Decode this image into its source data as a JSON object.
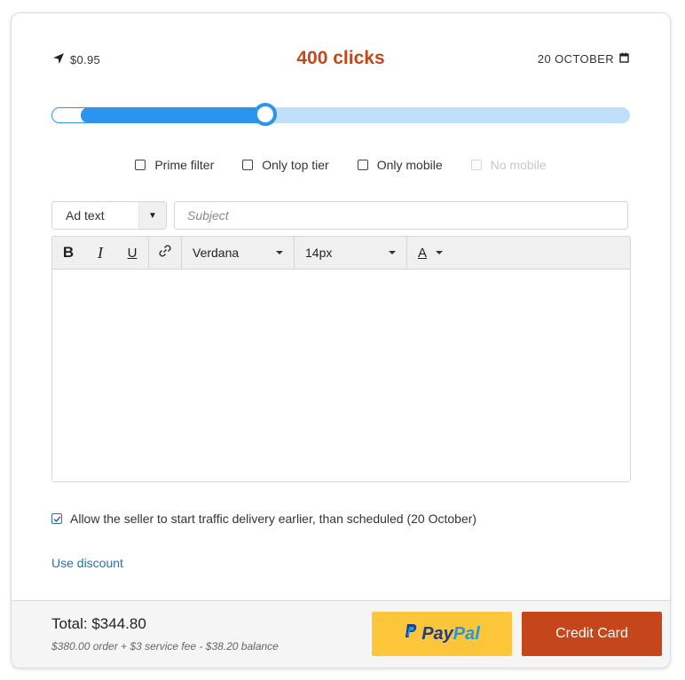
{
  "header": {
    "price": "$0.95",
    "clicks": "400 clicks",
    "date": "20 OCTOBER"
  },
  "slider": {
    "value_fraction": 0.37
  },
  "options": [
    {
      "label": "Prime filter",
      "checked": false,
      "disabled": false
    },
    {
      "label": "Only top tier",
      "checked": false,
      "disabled": false
    },
    {
      "label": "Only mobile",
      "checked": false,
      "disabled": false
    },
    {
      "label": "No mobile",
      "checked": false,
      "disabled": true
    }
  ],
  "ad_type": {
    "selected": "Ad text"
  },
  "subject": {
    "placeholder": "Subject",
    "value": ""
  },
  "editor": {
    "bold_icon": "B",
    "italic_icon": "I",
    "underline_icon": "U",
    "text_color_icon": "A",
    "font": "Verdana",
    "size": "14px",
    "content": ""
  },
  "allow_early": {
    "label": "Allow the seller to start traffic delivery earlier, than scheduled (20 October)",
    "checked": true
  },
  "discount": {
    "label": "Use discount"
  },
  "footer": {
    "total": "Total: $344.80",
    "breakdown": "$380.00 order + $3 service fee - $38.20 balance",
    "paypal_pay": "Pay",
    "paypal_pal": "Pal",
    "credit_card": "Credit Card"
  },
  "colors": {
    "accent": "#c4461a",
    "slider_blue": "#2a94ee",
    "slider_light": "#bfdffb",
    "paypal_yellow": "#fcc53a",
    "link_blue": "#2a6fb4"
  }
}
